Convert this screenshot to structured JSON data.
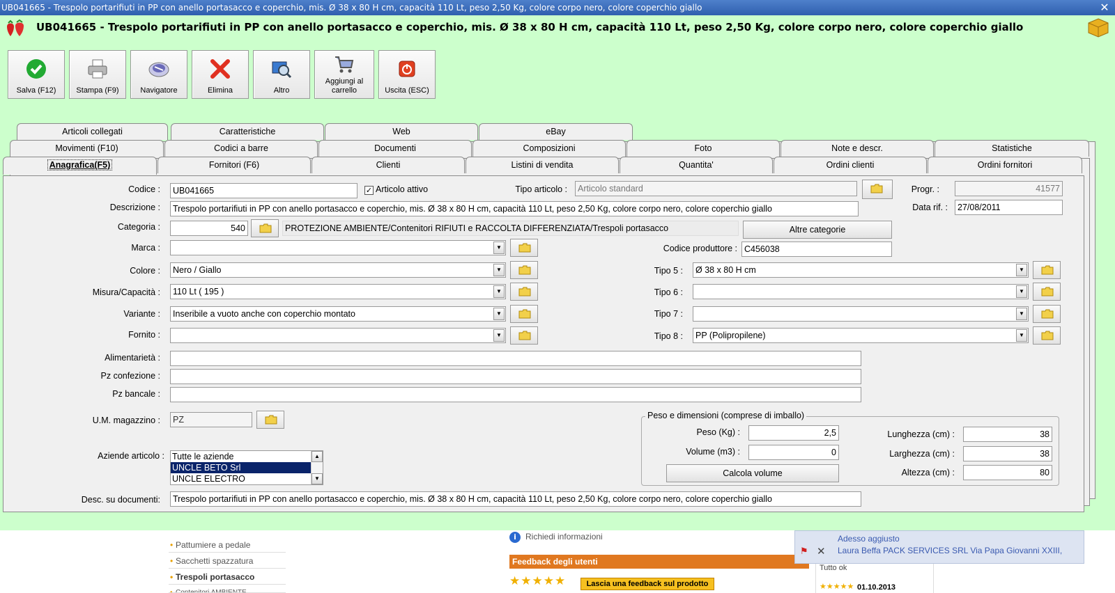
{
  "window": {
    "title": "UB041665 - Trespolo portarifiuti in PP con anello portasacco e coperchio, mis. Ø 38 x 80 H cm, capacità 110 Lt, peso 2,50 Kg, colore corpo nero, colore coperchio giallo"
  },
  "header": {
    "title": "UB041665 - Trespolo portarifiuti in PP con anello portasacco e coperchio, mis. Ø 38 x 80 H cm, capacità 110 Lt, peso 2,50 Kg, colore corpo nero, colore coperchio giallo"
  },
  "toolbar": {
    "save": "Salva (F12)",
    "print": "Stampa (F9)",
    "navigator": "Navigatore",
    "delete": "Elimina",
    "other": "Altro",
    "add_cart_1": "Aggiungi al",
    "add_cart_2": "carrello",
    "exit": "Uscita (ESC)"
  },
  "tabs": {
    "row1": [
      "Articoli collegati",
      "Caratteristiche",
      "Web",
      "eBay"
    ],
    "row2": [
      "Movimenti (F10)",
      "Codici a barre",
      "Documenti",
      "Composizioni",
      "Foto",
      "Note e descr.",
      "Statistiche"
    ],
    "row3": [
      "Anagrafica(F5)",
      "Fornitori (F6)",
      "Clienti",
      "Listini di vendita",
      "Quantita'",
      "Ordini clienti",
      "Ordini fornitori"
    ]
  },
  "form": {
    "codice_label": "Codice :",
    "codice": "UB041665",
    "attivo_label": "Articolo attivo",
    "tipo_label": "Tipo articolo :",
    "tipo_placeholder": "Articolo standard",
    "progr_label": "Progr. :",
    "progr": "41577",
    "descr_label": "Descrizione :",
    "descr": "Trespolo portarifiuti in PP con anello portasacco e coperchio, mis. Ø 38 x 80 H cm, capacità 110 Lt, peso 2,50 Kg, colore corpo nero, colore coperchio giallo",
    "datarif_label": "Data rif. :",
    "datarif": "27/08/2011",
    "categoria_label": "Categoria :",
    "categoria": "540",
    "categoria_path": "PROTEZIONE AMBIENTE/Contenitori RIFIUTI e RACCOLTA DIFFERENZIATA/Trespoli portasacco",
    "altre_categorie": "Altre categorie",
    "marca_label": "Marca :",
    "marca": "",
    "codprod_label": "Codice produttore :",
    "codprod": "C456038",
    "colore_label": "Colore :",
    "colore": "Nero / Giallo",
    "misura_label": "Misura/Capacità :",
    "misura": "110 Lt ( 195 )",
    "variante_label": "Variante :",
    "variante": "Inseribile a vuoto anche con coperchio montato",
    "fornito_label": "Fornito :",
    "fornito": "",
    "tipo5_label": "Tipo 5 :",
    "tipo5": "Ø 38 x 80 H cm",
    "tipo6_label": "Tipo 6 :",
    "tipo6": "",
    "tipo7_label": "Tipo 7 :",
    "tipo7": "",
    "tipo8_label": "Tipo 8 :",
    "tipo8": "PP (Polipropilene)",
    "alimentarieta_label": "Alimentarietà :",
    "pzconf_label": "Pz confezione :",
    "pzbanc_label": "Pz bancale :",
    "um_label": "U.M. magazzino :",
    "um": "PZ",
    "aziende_label": "Aziende articolo :",
    "aziende": [
      "Tutte le aziende",
      "UNCLE BETO Srl",
      "UNCLE ELECTRO"
    ],
    "descdoc_label": "Desc. su documenti:",
    "descdoc": "Trespolo portarifiuti in PP con anello portasacco e coperchio, mis. Ø 38 x 80 H cm, capacità 110 Lt, peso 2,50 Kg, colore corpo nero, colore coperchio giallo"
  },
  "peso": {
    "group_title": "Peso e dimensioni (comprese di imballo)",
    "peso_label": "Peso (Kg) :",
    "peso": "2,5",
    "volume_label": "Volume (m3) :",
    "volume": "0",
    "calcola": "Calcola volume",
    "lung_label": "Lunghezza (cm) :",
    "lung": "38",
    "larg_label": "Larghezza (cm) :",
    "larg": "38",
    "alt_label": "Altezza (cm) :",
    "alt": "80"
  },
  "web": {
    "side": [
      "Pattumiere a pedale",
      "Sacchetti spazzatura",
      "Trespoli portasacco",
      "Contenitori AMBIENTE"
    ],
    "richiedi": "Richiedi informazioni",
    "feedback_header": "Feedback degli utenti",
    "feedback_button": "Lascia una feedback sul prodotto",
    "notify_1": "Adesso aggiusto",
    "notify_2": "Laura Beffa PACK SERVICES SRL Via Papa Giovanni XXIII,",
    "tutto_ok": "Tutto ok",
    "date": "01.10.2013"
  },
  "colors": {
    "app_bg": "#ccffcc",
    "titlebar": "#3a6bbd",
    "panel": "#f0f0f0",
    "selected": "#0a246a"
  }
}
